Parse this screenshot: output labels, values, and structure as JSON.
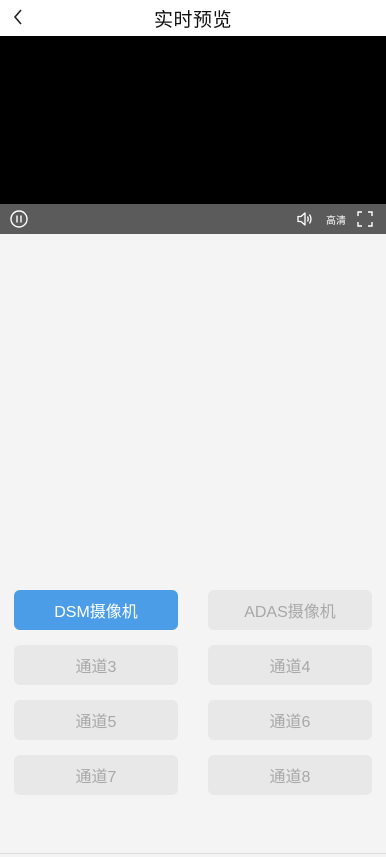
{
  "header": {
    "title": "实时预览",
    "back_icon": "chevron-left-icon"
  },
  "player": {
    "quality_label": "高清",
    "icons": [
      "pause-icon",
      "volume-icon",
      "fullscreen-icon"
    ]
  },
  "channels": {
    "items": [
      {
        "label": "DSM摄像机",
        "active": true
      },
      {
        "label": "ADAS摄像机",
        "active": false
      },
      {
        "label": "通道3",
        "active": false
      },
      {
        "label": "通道4",
        "active": false
      },
      {
        "label": "通道5",
        "active": false
      },
      {
        "label": "通道6",
        "active": false
      },
      {
        "label": "通道7",
        "active": false
      },
      {
        "label": "通道8",
        "active": false
      }
    ]
  },
  "colors": {
    "active": "#4c9de8",
    "inactive_bg": "#e8e8e8",
    "inactive_text": "#a8a8a8",
    "control_bar": "#5b5b5b"
  }
}
